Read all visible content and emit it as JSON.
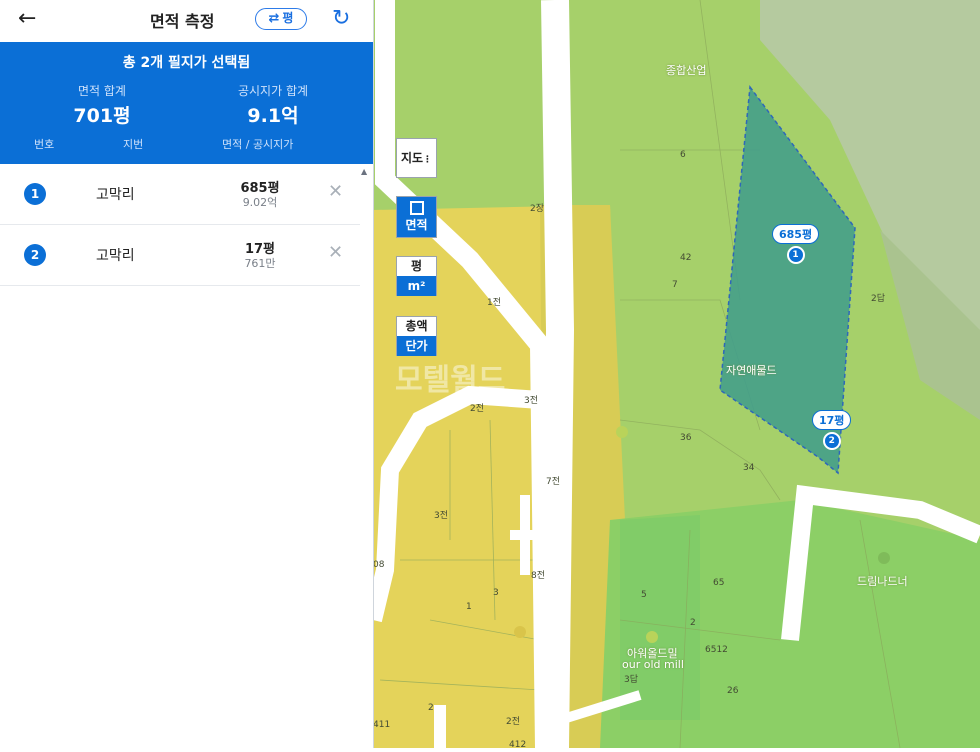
{
  "header": {
    "back_label": "←",
    "title": "면적 측정",
    "unit_toggle_label": "평",
    "reset_label": "↻"
  },
  "summary": {
    "title": "총 2개 필지가 선택됨",
    "area_total_label": "면적 합계",
    "area_total_value": "701평",
    "price_total_label": "공시지가 합계",
    "price_total_value": "9.1억",
    "col_number": "번호",
    "col_parcel": "지번",
    "col_area_price": "면적 / 공시지가"
  },
  "parcels": [
    {
      "num": "1",
      "name": "고막리",
      "area": "685평",
      "price": "9.02억"
    },
    {
      "num": "2",
      "name": "고막리",
      "area": "17평",
      "price": "761만"
    }
  ],
  "map_controls": {
    "map_type": "지도",
    "area_mode": "면적",
    "unit_pyeong": "평",
    "unit_m2": "m²",
    "total": "총액",
    "unit_price": "단가"
  },
  "markers": [
    {
      "num": "1",
      "label": "685평"
    },
    {
      "num": "2",
      "label": "17평"
    }
  ],
  "map_labels": {
    "lots": [
      "6",
      "42",
      "7",
      "2답",
      "2장",
      "1전",
      "2전",
      "3전",
      "7전",
      "3전",
      "8전",
      "3",
      "1",
      "2",
      "2전",
      "3답",
      "5",
      "2",
      "26",
      "412",
      "411",
      "08",
      "34",
      "36",
      "65",
      "6512"
    ],
    "places": [
      "종합산업",
      "자연애물드",
      "아워올드밀",
      "our old mill",
      "드림나드너"
    ],
    "watermark": "모텔월드"
  },
  "colors": {
    "brand_blue": "#0b6fd6",
    "zone_green": "#a8d46e",
    "zone_yellow": "#e6d45a",
    "selected_parcel": "#3f9d8c"
  }
}
